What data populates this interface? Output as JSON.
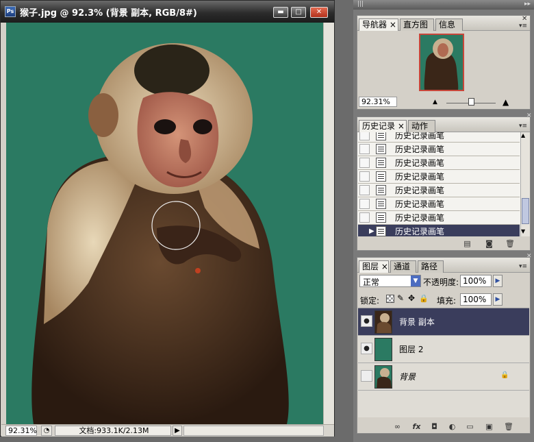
{
  "document": {
    "title": "猴子.jpg @ 92.3% (背景 副本, RGB/8#)",
    "zoom": "92.31%",
    "doc_info": "文档:933.1K/2.13M",
    "canvas_color": "#2b7a62"
  },
  "window_buttons": {
    "minimize": "▬",
    "maximize": "□",
    "close": "✕"
  },
  "navigator_panel": {
    "tabs": [
      "导航器",
      "直方图",
      "信息"
    ],
    "zoom": "92.31%"
  },
  "history_panel": {
    "tabs": [
      "历史记录",
      "动作"
    ],
    "items": [
      "历史记录画笔",
      "历史记录画笔",
      "历史记录画笔",
      "历史记录画笔",
      "历史记录画笔",
      "历史记录画笔",
      "历史记录画笔",
      "历史记录画笔"
    ],
    "selected_index": 7
  },
  "layers_panel": {
    "tabs": [
      "图层",
      "通道",
      "路径"
    ],
    "blend_mode": "正常",
    "opacity_label": "不透明度:",
    "opacity": "100%",
    "lock_label": "锁定:",
    "fill_label": "填充:",
    "fill": "100%",
    "layers": [
      {
        "name": "背景 副本",
        "visible": true,
        "selected": true
      },
      {
        "name": "图层 2",
        "visible": true,
        "selected": false
      },
      {
        "name": "背景",
        "visible": false,
        "selected": false,
        "locked": true
      }
    ]
  },
  "colors": {
    "selection": "#3a3d5c",
    "panel_bg": "#d4d0c8",
    "nav_frame": "#c8463a"
  }
}
